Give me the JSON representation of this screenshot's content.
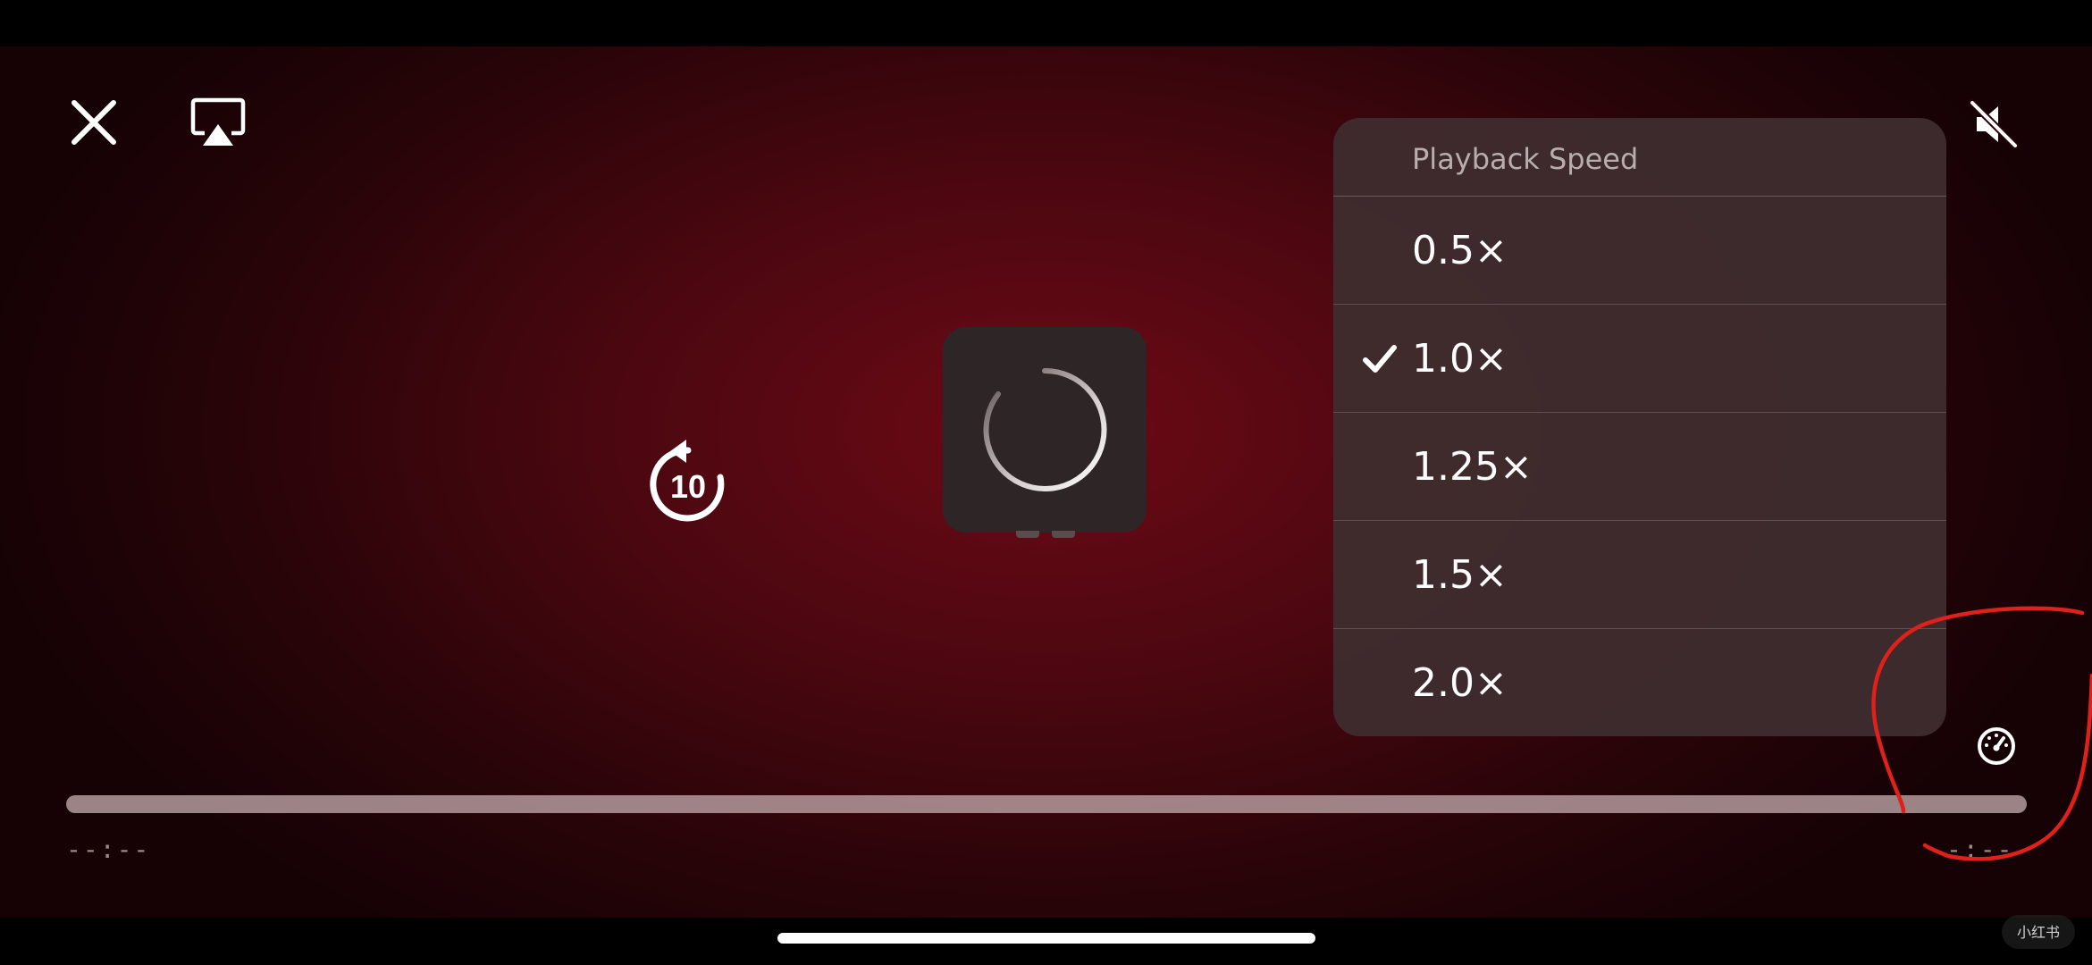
{
  "player": {
    "controls": {
      "close_icon": "close-x-icon",
      "airplay_icon": "airplay-icon",
      "mute_icon": "speaker-muted-icon",
      "skip_back_icon": "skip-back-10-icon",
      "skip_back_seconds": "10",
      "speed_icon": "speedometer-icon"
    },
    "speed_menu": {
      "title": "Playback Speed",
      "selected": "1.0×",
      "options": [
        "0.5×",
        "1.0×",
        "1.25×",
        "1.5×",
        "2.0×"
      ]
    },
    "time": {
      "elapsed": "--:--",
      "remaining": "-:--"
    },
    "annotation_color": "#e0201a",
    "accent": "#ffffff",
    "watermark": "小红书"
  }
}
